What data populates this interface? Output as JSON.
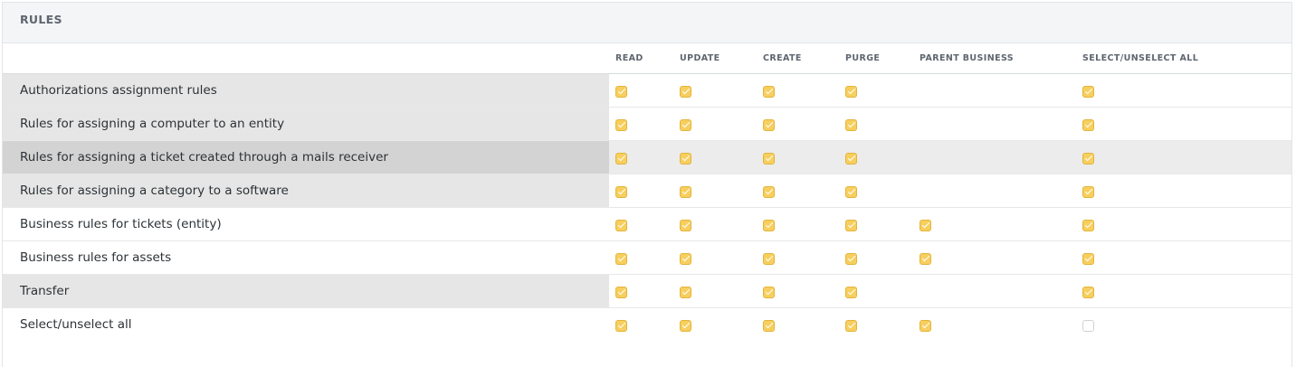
{
  "section": {
    "title": "RULES"
  },
  "columns": [
    "READ",
    "UPDATE",
    "CREATE",
    "PURGE",
    "PARENT BUSINESS",
    "SELECT/UNSELECT ALL"
  ],
  "rows": [
    {
      "label": "Authorizations assignment rules",
      "checks": [
        true,
        true,
        true,
        true,
        null,
        true
      ]
    },
    {
      "label": "Rules for assigning a computer to an entity",
      "checks": [
        true,
        true,
        true,
        true,
        null,
        true
      ]
    },
    {
      "label": "Rules for assigning a ticket created through a mails receiver",
      "checks": [
        true,
        true,
        true,
        true,
        null,
        true
      ]
    },
    {
      "label": "Rules for assigning a category to a software",
      "checks": [
        true,
        true,
        true,
        true,
        null,
        true
      ]
    },
    {
      "label": "Business rules for tickets (entity)",
      "checks": [
        true,
        true,
        true,
        true,
        true,
        true
      ]
    },
    {
      "label": "Business rules for assets",
      "checks": [
        true,
        true,
        true,
        true,
        true,
        true
      ]
    },
    {
      "label": "Transfer",
      "checks": [
        true,
        true,
        true,
        true,
        null,
        true
      ]
    },
    {
      "label": "Select/unselect all",
      "checks": [
        true,
        true,
        true,
        true,
        true,
        false
      ]
    }
  ],
  "colors": {
    "accent": "#f7cf5f",
    "accent_border": "#e3b43a"
  }
}
